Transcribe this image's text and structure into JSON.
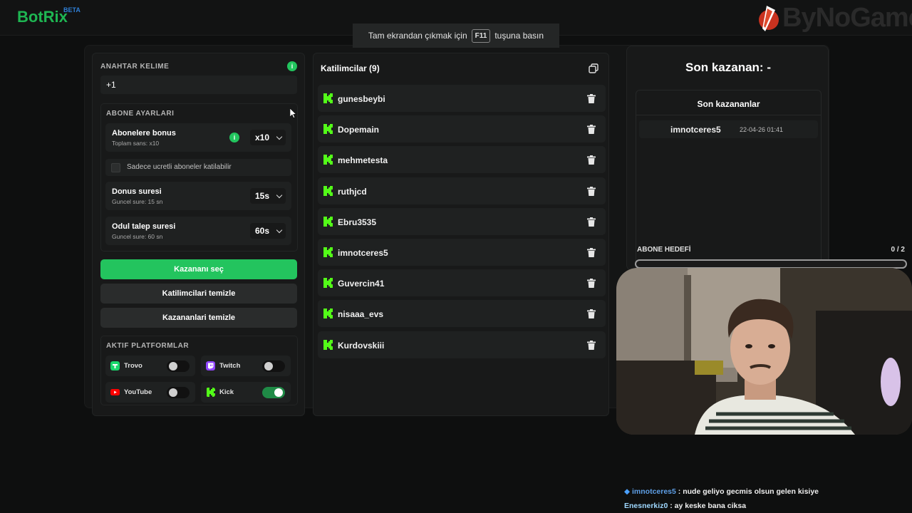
{
  "header": {
    "logo": "BotRix",
    "logo_badge": "BETA",
    "brand": "ByNoGame",
    "fullscreen_hint": {
      "before": "Tam ekrandan çıkmak için",
      "key": "F11",
      "after": "tuşuna basın"
    }
  },
  "left_panel": {
    "keyword_label": "ANAHTAR KELIME",
    "keyword_status_icon": "info-icon",
    "keyword_value": "+1",
    "subscriber_settings_label": "ABONE AYARLARI",
    "sub_bonus": {
      "title": "Abonelere bonus",
      "subtitle": "Toplam sans: x10",
      "value": "x10"
    },
    "paid_only_label": "Sadece ucretli aboneler katilabilir",
    "spin_duration": {
      "title": "Donus suresi",
      "subtitle": "Guncel sure: 15 sn",
      "value": "15s"
    },
    "claim_duration": {
      "title": "Odul talep suresi",
      "subtitle": "Guncel sure: 60 sn",
      "value": "60s"
    },
    "pick_winner_button": "Kazananı seç",
    "clear_participants_button": "Katilimcilari temizle",
    "clear_winners_button": "Kazananlari temizle",
    "platforms_label": "AKTIF PLATFORMLAR",
    "platforms": [
      {
        "name": "Trovo",
        "icon": "trovo-icon",
        "color": "#19d66b",
        "enabled": false
      },
      {
        "name": "Twitch",
        "icon": "twitch-icon",
        "color": "#9146ff",
        "enabled": false
      },
      {
        "name": "YouTube",
        "icon": "youtube-icon",
        "color": "#ff0000",
        "enabled": false
      },
      {
        "name": "Kick",
        "icon": "kick-icon",
        "color": "#53fc18",
        "enabled": true
      }
    ]
  },
  "participants": {
    "title": "Katilimcilar (9)",
    "copy_icon": "copy-icon",
    "items": [
      "gunesbeybi",
      "Dopemain",
      "mehmetesta",
      "ruthjcd",
      "Ebru3535",
      "imnotceres5",
      "Guvercin41",
      "nisaaa_evs",
      "Kurdovskiii"
    ]
  },
  "winner_panel": {
    "title": "Son kazanan: -",
    "list_title": "Son kazananlar",
    "winners": [
      {
        "name": "imnotceres5",
        "date": "22-04-26 01:41"
      }
    ]
  },
  "sub_goal": {
    "label": "ABONE HEDEFİ",
    "count": "0 / 2",
    "current": 0,
    "target": 2
  },
  "chat": [
    {
      "user": "imnotceres5",
      "message": " : nude geliyo gecmis olsun gelen kisiye",
      "badge": "bits-icon"
    },
    {
      "user": "Enesnerkiz0",
      "message": " : ay keske bana ciksa"
    }
  ],
  "colors": {
    "accent_green": "#23c45e",
    "kick_green": "#53fc18",
    "brand_red": "#d33a2a",
    "chat_user": "#5fa0e8"
  }
}
